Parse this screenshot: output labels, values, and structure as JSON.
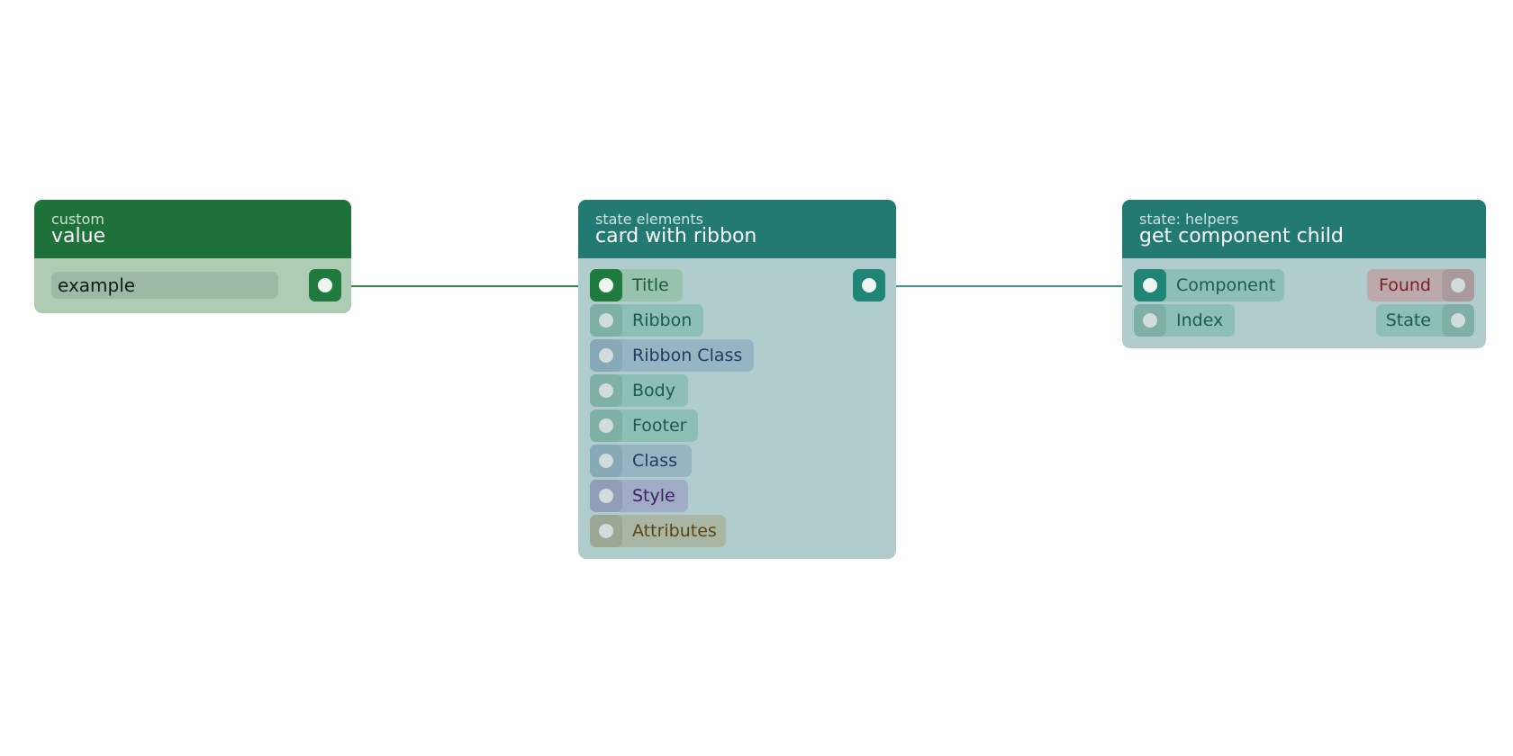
{
  "nodes": {
    "value": {
      "category": "custom",
      "title": "value",
      "field_value": "example"
    },
    "card": {
      "category": "state elements",
      "title": "card with ribbon",
      "inputs": [
        "Title",
        "Ribbon",
        "Ribbon Class",
        "Body",
        "Footer",
        "Class",
        "Style",
        "Attributes"
      ]
    },
    "child": {
      "category": "state: helpers",
      "title": "get component child",
      "inputs": [
        "Component",
        "Index"
      ],
      "outputs": [
        "Found",
        "State"
      ]
    }
  },
  "colors": {
    "value_header": "#1e7239",
    "state_header": "#227a72",
    "wire_green": "#2e8b4c",
    "wire_teal": "#3a968a"
  }
}
